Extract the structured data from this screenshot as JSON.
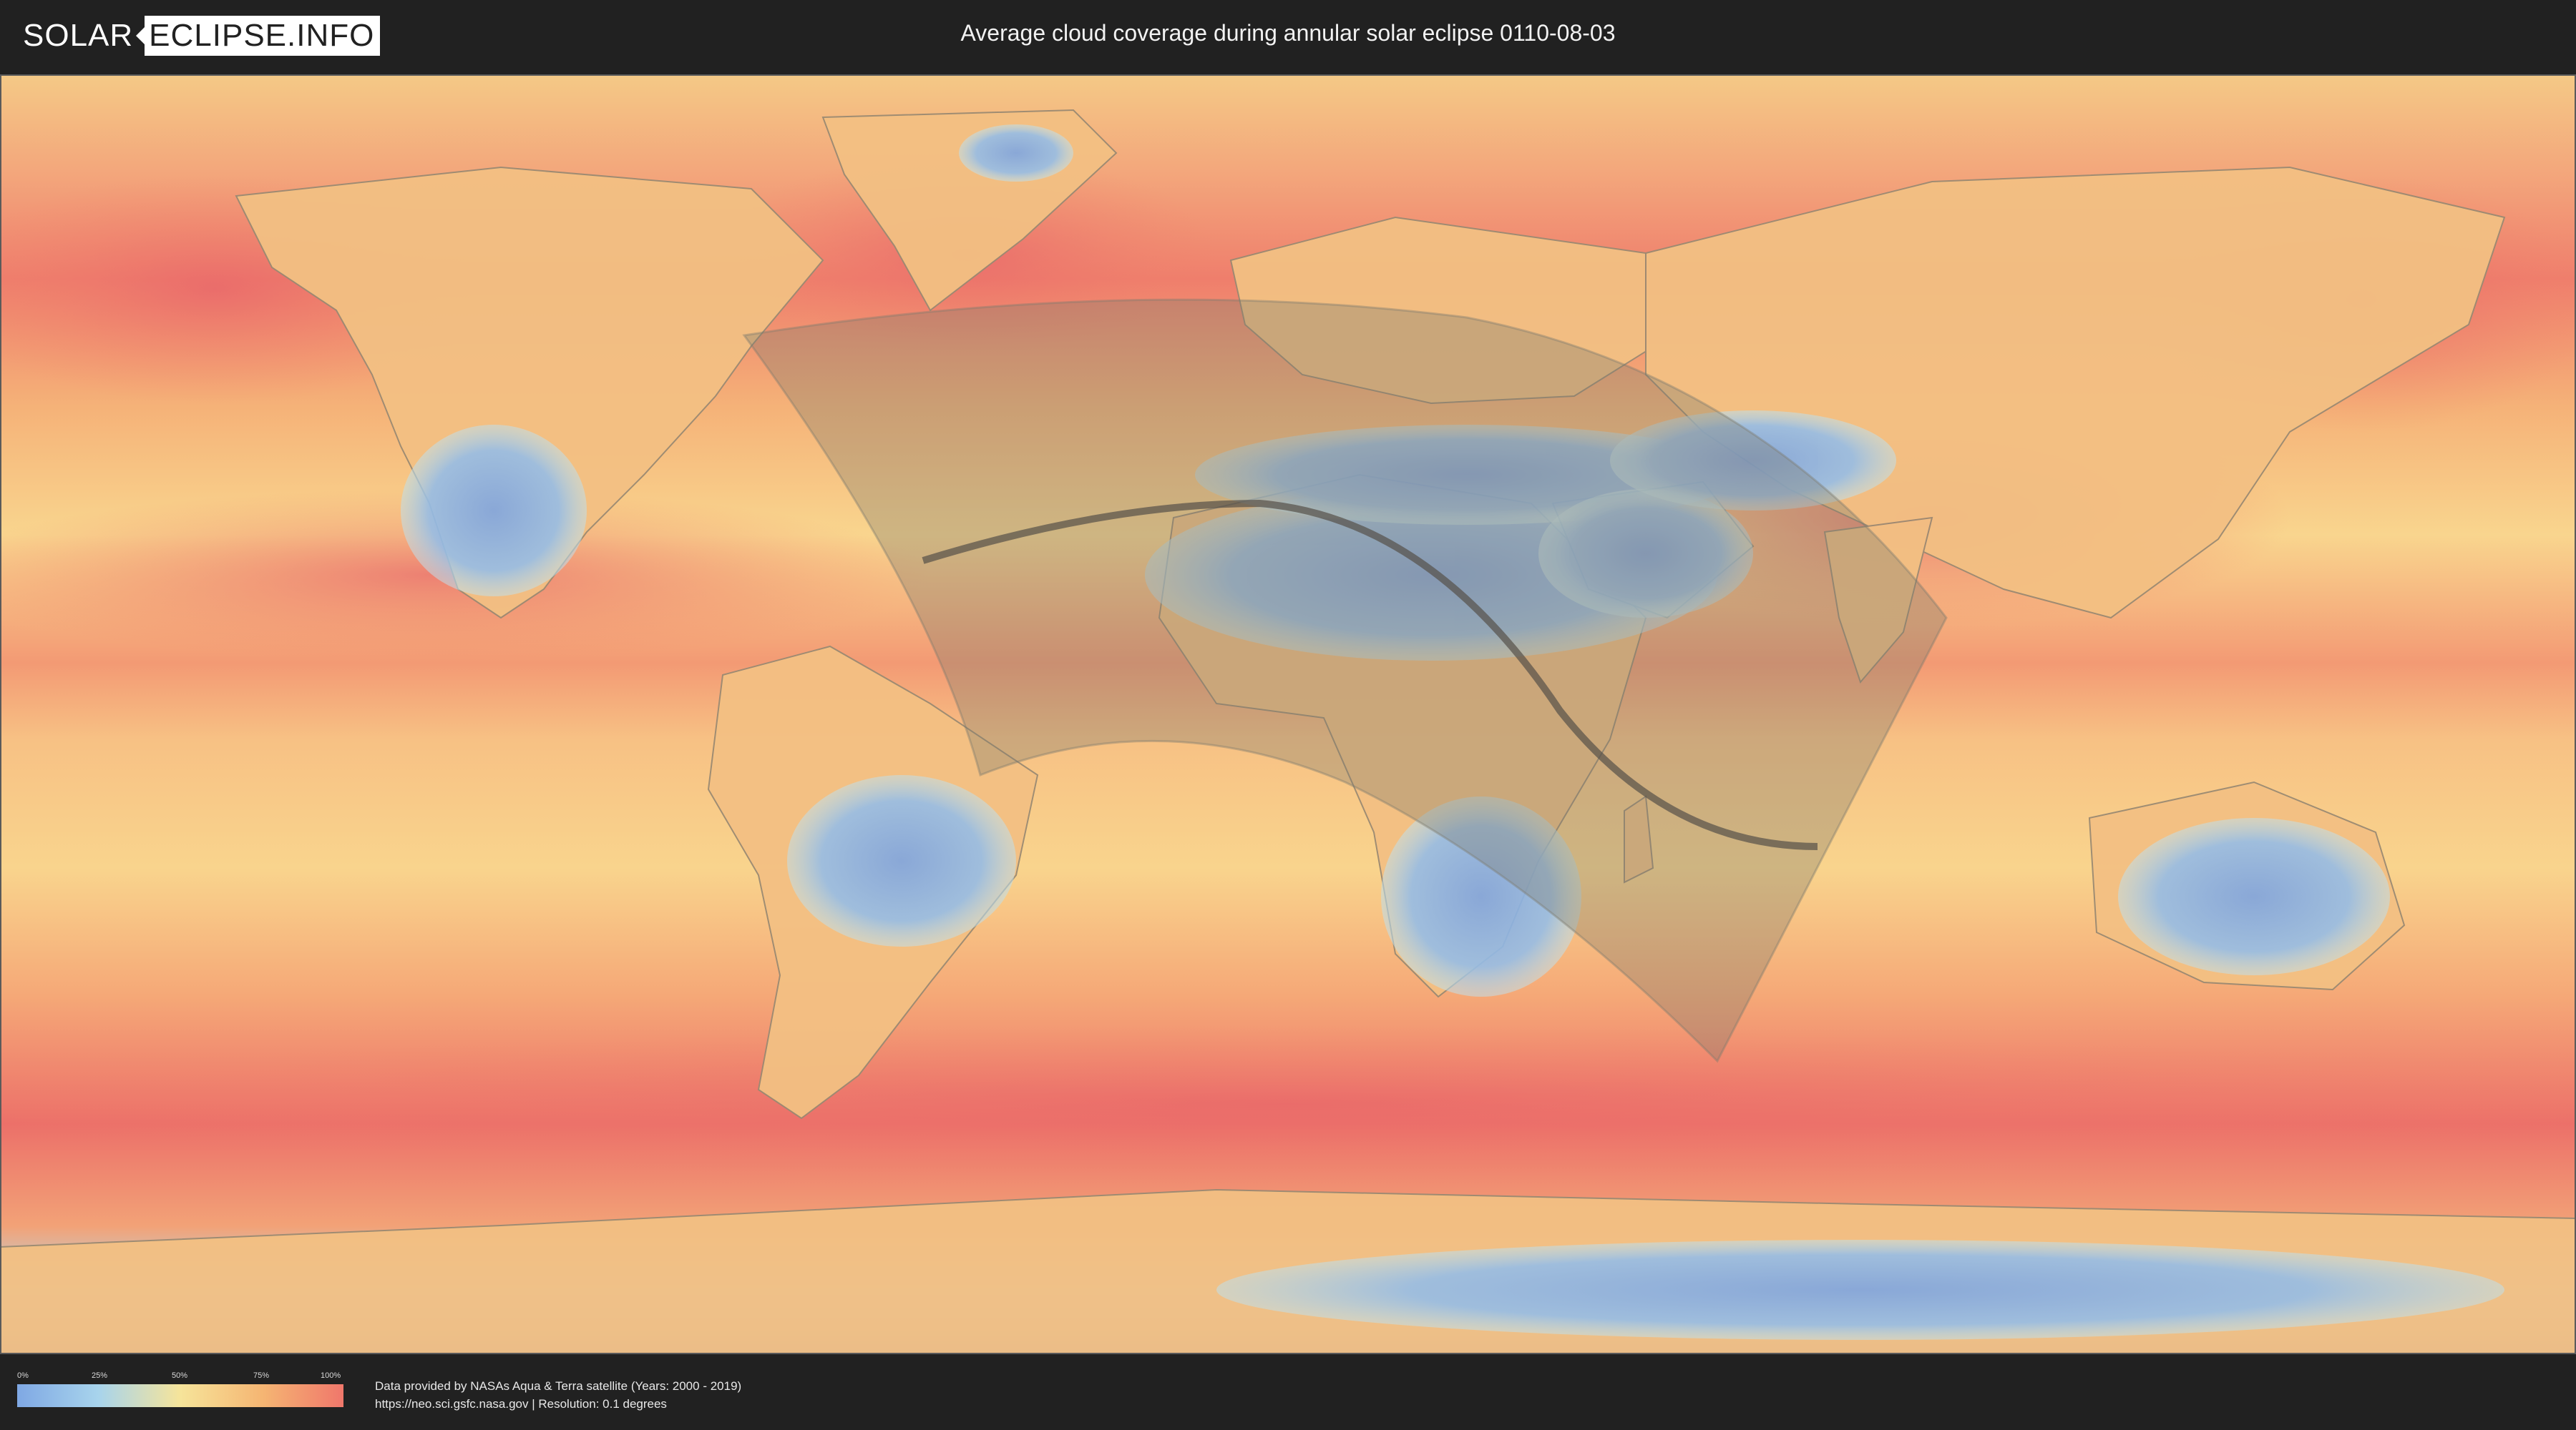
{
  "header": {
    "logo_left": "SOLAR",
    "logo_right": "ECLIPSE.INFO",
    "title": "Average cloud coverage during annular solar eclipse 0110-08-03"
  },
  "legend": {
    "ticks": [
      "0%",
      "25%",
      "50%",
      "75%",
      "100%"
    ],
    "colors": [
      "#7fa8e4",
      "#a8d4ec",
      "#f6e49a",
      "#f5b673",
      "#f0776b"
    ]
  },
  "credits": {
    "line1": "Data provided by NASAs Aqua & Terra satellite (Years: 2000 - 2019)",
    "line2": "https://neo.sci.gsfc.nasa.gov | Resolution: 0.1 degrees"
  },
  "map": {
    "ocean_color": "#f2956f",
    "eclipse_region_color": "#7d7a6e",
    "central_line_color": "#555048"
  }
}
